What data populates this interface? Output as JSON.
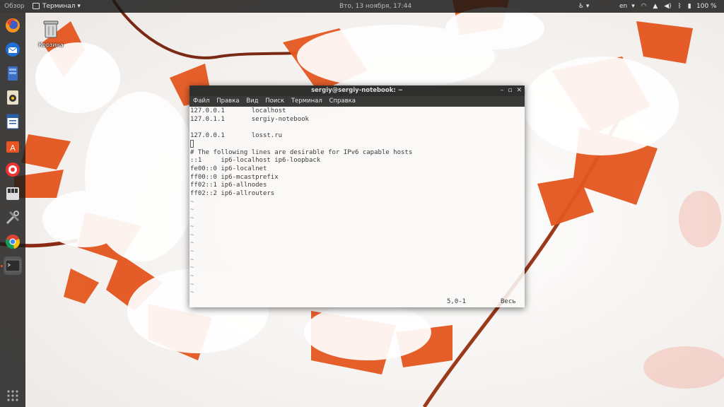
{
  "topbar": {
    "activities": "Обзор",
    "app_menu": "Терминал",
    "clock": "Вто, 13 ноября, 17:44",
    "keyboard_layout": "en",
    "battery_percent": "100 %"
  },
  "desktop": {
    "trash_label": "Корзина"
  },
  "dock": {
    "items": [
      "firefox-icon",
      "thunderbird-icon",
      "files-icon",
      "rhythmbox-icon",
      "libreoffice-writer-icon",
      "ubuntu-software-icon",
      "help-icon",
      "games-icon",
      "settings-icon",
      "chrome-icon",
      "terminal-icon"
    ]
  },
  "terminal": {
    "title": "sergiy@sergiy-notebook: ~",
    "menu": [
      "Файл",
      "Правка",
      "Вид",
      "Поиск",
      "Терминал",
      "Справка"
    ],
    "lines": [
      "127.0.0.1       localhost",
      "127.0.1.1       sergiy-notebook",
      "",
      "127.0.0.1       losst.ru",
      "",
      "# The following lines are desirable for IPv6 capable hosts",
      "::1     ip6-localhost ip6-loopback",
      "fe00::0 ip6-localnet",
      "ff00::0 ip6-mcastprefix",
      "ff02::1 ip6-allnodes",
      "ff02::2 ip6-allrouters"
    ],
    "tilde": "~",
    "status_position": "5,0-1",
    "status_scroll": "Весь"
  },
  "colors": {
    "accent": "#e95420",
    "topbar_bg": "#141414",
    "dock_bg": "#191919",
    "term_titlebar": "#2f2f2d"
  }
}
